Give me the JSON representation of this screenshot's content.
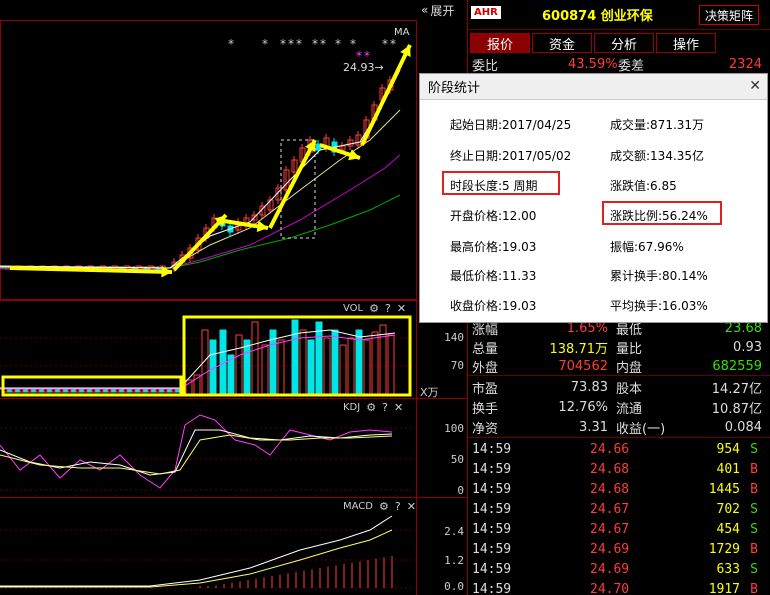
{
  "toolbar": {
    "expand_label": "展开",
    "expand_icon": "double-chevron-left"
  },
  "price_chart": {
    "ma_label": "MA",
    "high_price_label": "24.93",
    "high_arrow": "→"
  },
  "vol_panel": {
    "label": "VOL",
    "y_ticks": [
      "140",
      "70"
    ],
    "unit": "X万"
  },
  "kdj_panel": {
    "label": "KDJ",
    "y_ticks": [
      "100",
      "50",
      "0"
    ]
  },
  "macd_panel": {
    "label": "MACD",
    "y_ticks": [
      "2.4",
      "1.2",
      "0.0"
    ]
  },
  "header": {
    "badge": "AHR",
    "code_name": "600874 创业环保",
    "decision_button": "决策矩阵"
  },
  "tabs": [
    {
      "label": "报价"
    },
    {
      "label": "资金"
    },
    {
      "label": "分析"
    },
    {
      "label": "操作"
    }
  ],
  "quote_top": {
    "label_l": "委比",
    "value_l": "43.59%",
    "label_r": "委差",
    "value_r": "2324"
  },
  "dialog": {
    "title": "阶段统计",
    "start_date": "起始日期:2017/04/25",
    "volume": "成交量:871.31万",
    "end_date": "终止日期:2017/05/02",
    "turnover": "成交额:134.35亿",
    "period": "时段长度:5 周期",
    "change_value": "涨跌值:6.85",
    "open_price": "开盘价格:12.00",
    "change_ratio": "涨跌比例:56.24%",
    "high_price": "最高价格:19.03",
    "amplitude": "振幅:67.96%",
    "low_price": "最低价格:11.33",
    "cum_turnover_rate": "累计换手:80.14%",
    "close_price": "收盘价格:19.03",
    "avg_turnover_rate": "平均换手:16.03%"
  },
  "stats": [
    {
      "l1": "涨幅",
      "v1": "1.65%",
      "l2": "最低",
      "v2": "23.68",
      "c1": "red",
      "c2": "green"
    },
    {
      "l1": "总量",
      "v1": "138.71万",
      "l2": "量比",
      "v2": "0.93",
      "c1": "yellow",
      "c2": "white"
    },
    {
      "l1": "外盘",
      "v1": "704562",
      "l2": "内盘",
      "v2": "682559",
      "c1": "red",
      "c2": "green"
    },
    {
      "l1": "市盈",
      "v1": "73.83",
      "l2": "股本",
      "v2": "14.27亿",
      "c1": "white",
      "c2": "white"
    },
    {
      "l1": "换手",
      "v1": "12.76%",
      "l2": "流通",
      "v2": "10.87亿",
      "c1": "white",
      "c2": "white"
    },
    {
      "l1": "净资",
      "v1": "3.31",
      "l2": "收益(一)",
      "v2": "0.084",
      "c1": "white",
      "c2": "white"
    }
  ],
  "trades": [
    {
      "time": "14:59",
      "price": "24.66",
      "vol": "954",
      "side": "S"
    },
    {
      "time": "14:59",
      "price": "24.68",
      "vol": "401",
      "side": "B"
    },
    {
      "time": "14:59",
      "price": "24.68",
      "vol": "1445",
      "side": "B"
    },
    {
      "time": "14:59",
      "price": "24.67",
      "vol": "702",
      "side": "S"
    },
    {
      "time": "14:59",
      "price": "24.67",
      "vol": "454",
      "side": "S"
    },
    {
      "time": "14:59",
      "price": "24.69",
      "vol": "1729",
      "side": "B"
    },
    {
      "time": "14:59",
      "price": "24.69",
      "vol": "633",
      "side": "S"
    },
    {
      "time": "14:59",
      "price": "24.70",
      "vol": "1917",
      "side": "B"
    }
  ],
  "colors": {
    "up": "#ff3b3b",
    "down": "#00e5e5",
    "accent_yellow": "#ffff00",
    "box_red": "#e02020",
    "panel_border": "#8b0000"
  }
}
